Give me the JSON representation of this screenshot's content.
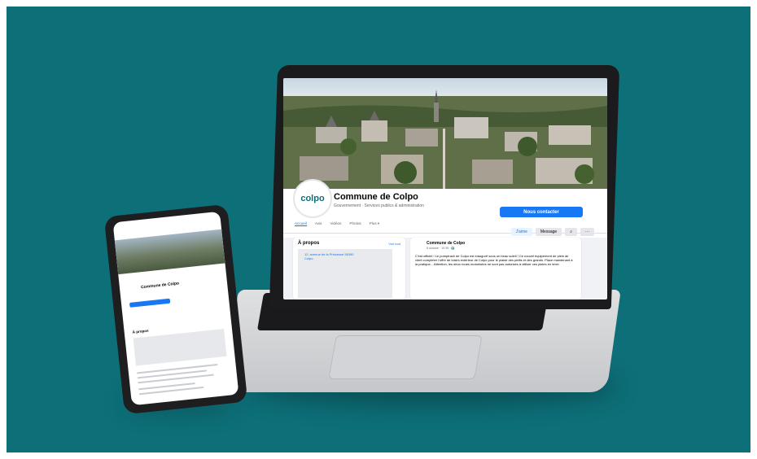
{
  "page": {
    "name": "Commune de Colpo",
    "category": "Gouvernement · Services publics & administration",
    "logo_text": "colpo",
    "contact_button": "Nous contacter",
    "tabs": [
      "Accueil",
      "Avis",
      "Vidéos",
      "Photos",
      "Plus ▾"
    ],
    "actions": {
      "like": "J'aime",
      "message": "Message"
    },
    "about": {
      "title": "À propos",
      "see_all": "Voir tout",
      "address": "12, avenue de la Princesse 56390 Colpo"
    },
    "post": {
      "author": "Commune de Colpo",
      "meta": "8 octobre · 10:39 · 🌍",
      "text": "C'est officiel ! Le pumptrack de Colpo est inauguré sous un beau soleil ! Ce nouvel équipement de plein air vient compléter l'offre de loisirs extérieur de Colpo pour le plaisir des petits et des grands. Place maintenant à la pratique... Attention, les deux roues motorisées ne sont pas autorisés à utiliser ces pistes en terre."
    }
  },
  "colors": {
    "background": "#0d6f78",
    "facebook_blue": "#1877f2"
  }
}
